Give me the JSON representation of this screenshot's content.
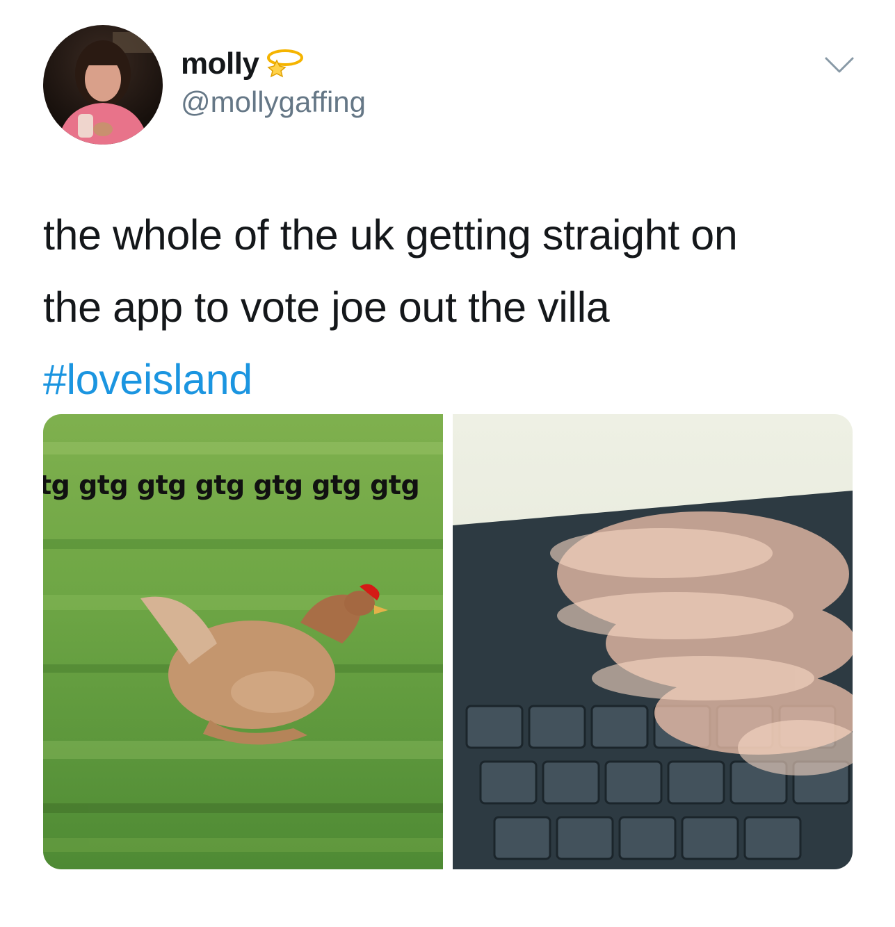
{
  "tweet": {
    "display_name": "molly",
    "handle": "@mollygaffing",
    "text_lines": [
      "the whole of the uk getting straight on",
      "the app to vote joe out the villa"
    ],
    "hashtag": "#loveisland",
    "name_emoji": "angel-halo-icon",
    "hashtag_emoji": "love-island-heart-icon"
  },
  "media": {
    "left_image_caption": "tg gtg gtg gtg gtg gtg gtg",
    "left_image_subject": "running-chicken-image",
    "right_image_subject": "fast-typing-keyboard-image"
  },
  "colors": {
    "text": "#14171a",
    "secondary": "#657786",
    "link": "#1b95e0",
    "background": "#ffffff"
  }
}
